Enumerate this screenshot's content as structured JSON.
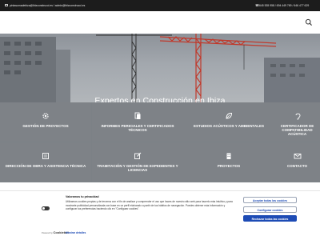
{
  "topbar": {
    "emails": "pintasumadebiza@ibizconstrucci.es  /  admin@ibizconstrucci.es",
    "phones": "645 535 958 / 694 449 769 / 646 477 629"
  },
  "hero": {
    "title": "Expertos en Construcción en Ibiza"
  },
  "services": [
    {
      "label": "GESTIÓN DE PROYECTOS",
      "icon": "gear-icon"
    },
    {
      "label": "INFORMES PERICIALES Y CERTIFICADOS TÉCNICOS",
      "icon": "document-icon"
    },
    {
      "label": "ESTUDIOS ACÚSTICOS Y AMBIENTALES",
      "icon": "leaf-icon"
    },
    {
      "label": "CERTIFICADOR DE COMPATIBILIDAD ACÚSTICA",
      "icon": "ear-icon"
    },
    {
      "label": "DIRECCIÓN DE OBRA Y ASISTENCIA TÉCNICA",
      "icon": "list-icon"
    },
    {
      "label": "TRAMITACIÓN Y GESTIÓN DE EXPEDIENTES Y LICENCIAS",
      "icon": "edit-icon"
    },
    {
      "label": "PROYECTOS",
      "icon": "building-icon"
    },
    {
      "label": "CONTACTO",
      "icon": "envelope-icon"
    }
  ],
  "cookie": {
    "title": "Valoramos tu privacidad",
    "text": "Utilizamos cookies propias y de terceros con el fin de analizar y comprender el uso que haces de nuestro sitio web para hacerlo más intuitivo y para mostrarte publicidad personalizada con base en un perfil elaborado a partir de tus hábitos de navegación. Puedes obtener más información y configurar tus preferencias haciendo clic en \"Configurar cookies\".",
    "powered_by": "Powered by",
    "brand": "Cookiebot",
    "show_purposes": "Mostrar detalles",
    "accept_label": "Aceptar todas las cookies",
    "config_label": "Configurar cookies",
    "reject_label": "Rechazar todas las cookies"
  }
}
